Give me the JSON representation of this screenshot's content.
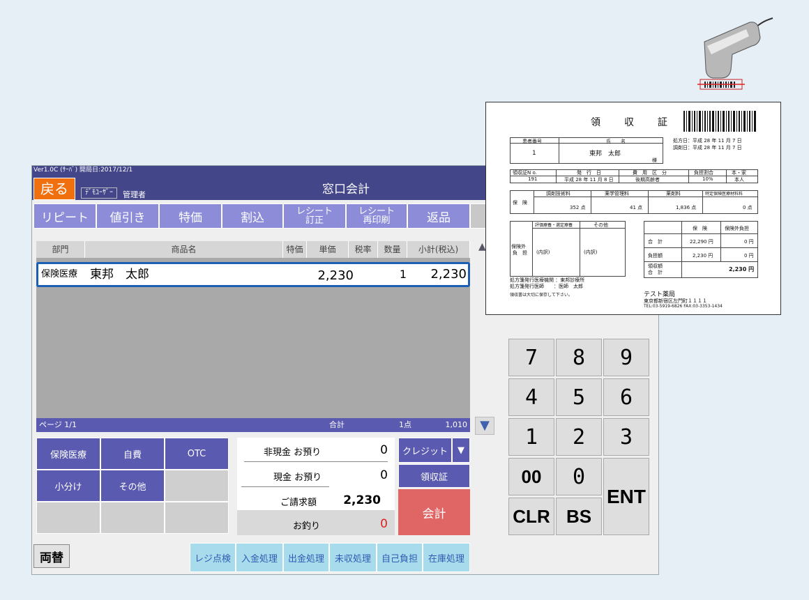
{
  "app": {
    "version_line": "Ver1.0C (ｻｰﾊﾞ) 開局日:2017/12/1",
    "back_label": "戻る",
    "staff_id": "ﾃﾞﾓﾕｰｻﾞｰ",
    "staff_name": "管理者",
    "title": "窓口会計"
  },
  "toolbar": [
    {
      "label": "リピート"
    },
    {
      "label": "値引き"
    },
    {
      "label": "特価"
    },
    {
      "label": "割込"
    },
    {
      "line1": "レシート",
      "line2": "訂正"
    },
    {
      "line1": "レシート",
      "line2": "再印刷"
    },
    {
      "label": "返品"
    }
  ],
  "table": {
    "headers": [
      "部門",
      "商品名",
      "特価",
      "単価",
      "税率",
      "数量",
      "小計(税込)"
    ],
    "rows": [
      {
        "dept": "保険医療",
        "name": "東邦　太郎",
        "special": "",
        "price": "2,230",
        "tax": "",
        "qty": "1",
        "subtotal": "2,230"
      }
    ],
    "footer": {
      "page": "ページ 1/1",
      "total_label": "合計",
      "count": "1点",
      "amount": "1,010"
    }
  },
  "categories": [
    {
      "label": "保険医療"
    },
    {
      "label": "自費"
    },
    {
      "label": "OTC"
    },
    {
      "label": "小分け"
    },
    {
      "label": "その他"
    }
  ],
  "payment": {
    "noncash_label": "非現金 お預り",
    "noncash_value": "0",
    "cash_label": "現金 お預り",
    "cash_value": "0",
    "billed_label": "ご請求額",
    "billed_value": "2,230",
    "change_label": "お釣り",
    "change_value": "0",
    "credit_label": "クレジット",
    "receipt_label": "領収証",
    "checkout_label": "会計"
  },
  "swap_label": "両替",
  "function_buttons": [
    "レジ点検",
    "入金処理",
    "出金処理",
    "未収処理",
    "自己負担",
    "在庫処理"
  ],
  "keypad": [
    "7",
    "8",
    "9",
    "4",
    "5",
    "6",
    "1",
    "2",
    "3",
    "00",
    "0",
    "CLR",
    "BS",
    "ENT"
  ],
  "receipt": {
    "title": "領　　収　　証",
    "patient_no_label": "患者番号",
    "patient_no": "1",
    "name_label": "氏　　名",
    "name": "東邦　太郎",
    "honorific": "様",
    "dates": [
      "処方日：平成 28 年 11 月 7 日",
      "調剤日：平成 28 年 11 月 7 日"
    ],
    "row2_headers": [
      "領収証N o.",
      "発　行　日",
      "費　用　区　分",
      "負担割合",
      "本・家"
    ],
    "row2_values": [
      "191",
      "平成 28 年 11 月 8 日",
      "後期高齢者",
      "10%",
      "本人"
    ],
    "row3_headers": [
      "調剤技術料",
      "薬学管理料",
      "薬剤料",
      "特定保険医療材料料"
    ],
    "row3_label": "保　険",
    "row3_values": [
      "352 点",
      "41 点",
      "1,836 点",
      "0 点"
    ],
    "other_headers": [
      "評価療養・選定療養",
      "その他"
    ],
    "other_label_1": "保険外",
    "other_label_2": "負　担",
    "other_note": "(内訳)",
    "sum_headers": [
      "保　険",
      "保険外負担"
    ],
    "sum_rows": [
      {
        "label": "合　計",
        "ins": "22,290 円",
        "out": "0 円"
      },
      {
        "label": "負担額",
        "ins": "2,230 円",
        "out": "0 円"
      }
    ],
    "collected_label_1": "領収額",
    "collected_label_2": "合　計",
    "collected_value": "2,230 円",
    "prescriber": [
      "処方箋発行医療機関 ：東邦診療所",
      "処方箋発行医師　　：医師　太郎"
    ],
    "keep_note": "領収書は大切に保存して下さい。",
    "pharmacy_name": "テスト薬局",
    "pharmacy_address": "東京都新宿区左門町１１１１",
    "pharmacy_tel": "TEL:03-5919-6826 FAX:03-3353-1434"
  }
}
